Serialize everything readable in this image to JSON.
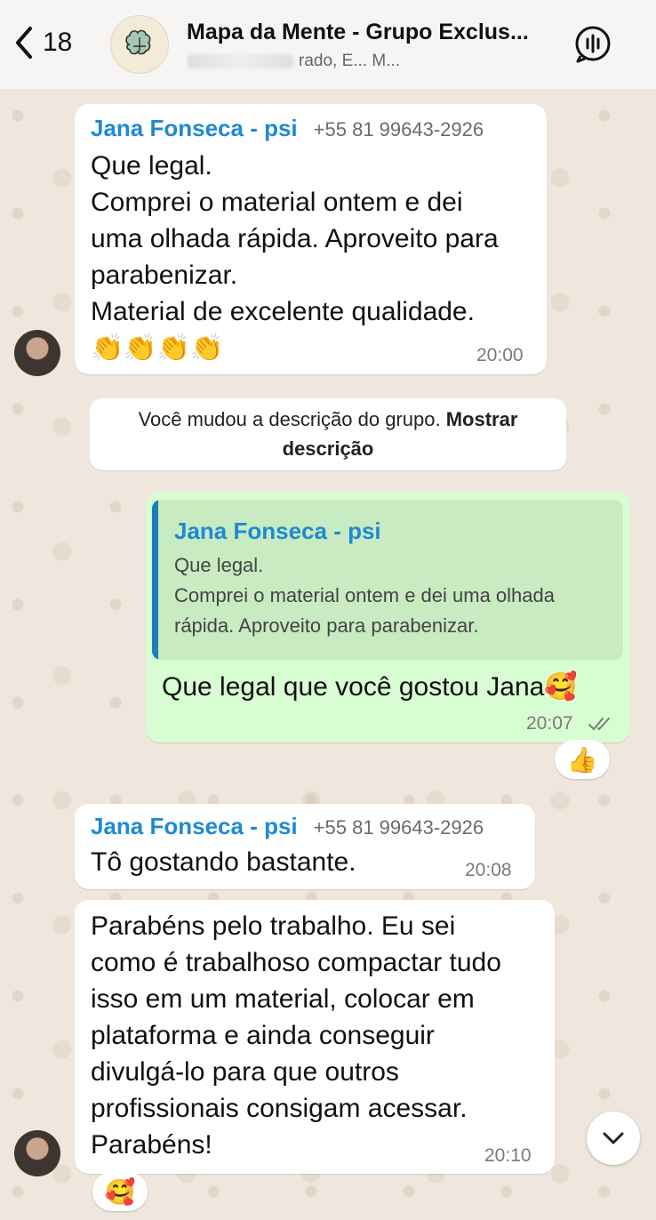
{
  "header": {
    "back_count": "18",
    "title": "Mapa da Mente - Grupo Exclus...",
    "subtitle": "rado, E... M..."
  },
  "messages": [
    {
      "sender": "Jana Fonseca - psi",
      "phone": "+55 81 99643-2926",
      "lines": [
        "Que legal.",
        "Comprei o material ontem e dei",
        "uma olhada rápida. Aproveito para",
        "parabenizar.",
        "Material de excelente qualidade."
      ],
      "emoji": "👏👏👏👏",
      "time": "20:00"
    },
    {
      "system_text": "Você mudou a descrição do grupo.",
      "system_link": "Mostrar",
      "system_link2": "descrição"
    },
    {
      "quote_name": "Jana Fonseca - psi",
      "quote_text": "Que legal.\nComprei o material ontem e dei uma olhada rápida. Aproveito para parabenizar.",
      "text": "Que legal que você gostou Jana🥰",
      "time": "20:07",
      "reaction": "👍"
    },
    {
      "sender": "Jana Fonseca - psi",
      "phone": "+55 81 99643-2926",
      "text": "Tô gostando bastante.",
      "time": "20:08"
    },
    {
      "lines": [
        "Parabéns pelo trabalho. Eu sei",
        "como é trabalhoso compactar tudo",
        "isso em um material, colocar em",
        "plataforma e ainda conseguir",
        "divulgá-lo para que outros",
        "profissionais consigam acessar.",
        "Parabéns!"
      ],
      "time": "20:10",
      "reaction": "🥰"
    }
  ],
  "colors": {
    "sender": "#1f8ad1",
    "outgoing_bubble": "#d9fdd3",
    "quote_bar": "#1a7fb8",
    "background": "#efe7dd"
  }
}
